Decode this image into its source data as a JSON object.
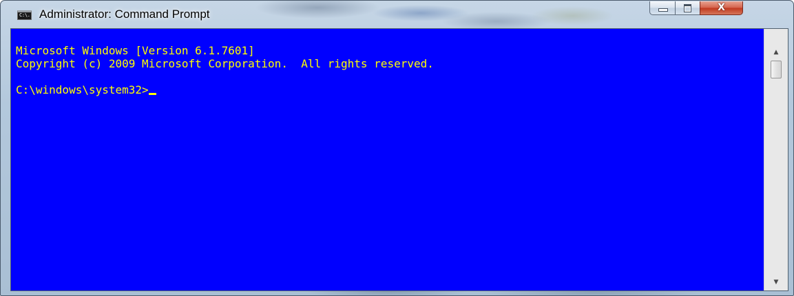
{
  "window": {
    "title": "Administrator: Command Prompt",
    "app_icon_text": "C:\\.",
    "buttons": {
      "minimize": "minimize",
      "maximize": "maximize",
      "close": "X"
    }
  },
  "console": {
    "lines": [
      "Microsoft Windows [Version 6.1.7601]",
      "Copyright (c) 2009 Microsoft Corporation.  All rights reserved.",
      "",
      "C:\\windows\\system32>"
    ],
    "text_color": "#ffff00",
    "background_color": "#0000ff"
  },
  "scrollbar": {
    "up_arrow": "▲",
    "down_arrow": "▼"
  },
  "icons": {
    "app": "command-prompt-icon",
    "minimize": "minimize-icon",
    "maximize": "maximize-icon",
    "close": "close-icon",
    "scroll_up": "scroll-up-arrow-icon",
    "scroll_down": "scroll-down-arrow-icon"
  }
}
